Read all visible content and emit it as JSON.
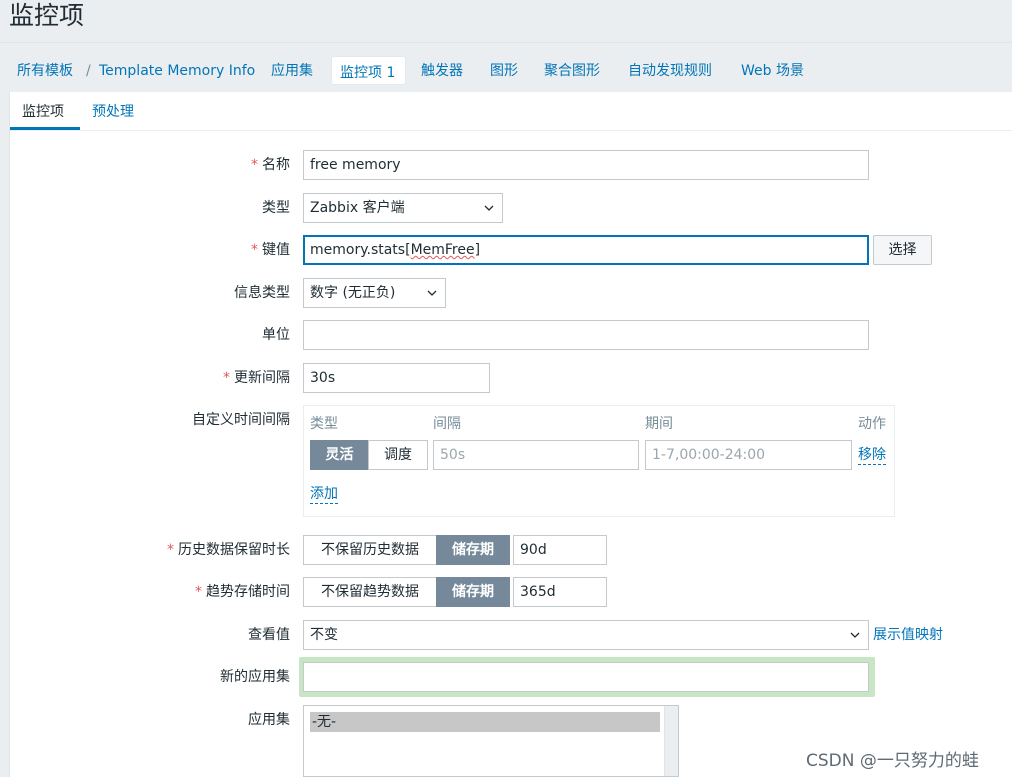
{
  "page": {
    "title": "监控项"
  },
  "nav": {
    "all_templates": "所有模板",
    "separator": "/",
    "template": "Template Memory Info",
    "applications": "应用集",
    "items": "监控项 1",
    "triggers": "触发器",
    "graphs": "图形",
    "screens": "聚合图形",
    "discovery": "自动发现规则",
    "web": "Web 场景"
  },
  "tabs": {
    "item": "监控项",
    "preprocessing": "预处理"
  },
  "form": {
    "required_mark": "*",
    "name": {
      "label": "名称",
      "value": "free memory"
    },
    "type": {
      "label": "类型",
      "value": "Zabbix 客户端"
    },
    "key": {
      "label": "键值",
      "value_prefix": "memory.stats[",
      "value_word": "MemFree",
      "value_suffix": "]",
      "button": "选择"
    },
    "info_type": {
      "label": "信息类型",
      "value": "数字 (无正负)"
    },
    "units": {
      "label": "单位",
      "value": ""
    },
    "update_interval": {
      "label": "更新间隔",
      "value": "30s"
    },
    "custom_intervals": {
      "label": "自定义时间间隔",
      "headers": {
        "type": "类型",
        "interval": "间隔",
        "period": "期间",
        "action": "动作"
      },
      "row": {
        "flexible": "灵活",
        "scheduling": "调度",
        "interval_placeholder": "50s",
        "period_placeholder": "1-7,00:00-24:00",
        "remove": "移除"
      },
      "add": "添加"
    },
    "history": {
      "label": "历史数据保留时长",
      "off_option": "不保留历史数据",
      "on_option": "储存期",
      "value": "90d"
    },
    "trends": {
      "label": "趋势存储时间",
      "off_option": "不保留趋势数据",
      "on_option": "储存期",
      "value": "365d"
    },
    "valuemap": {
      "label": "查看值",
      "value": "不变",
      "link": "展示值映射"
    },
    "new_application": {
      "label": "新的应用集",
      "value": ""
    },
    "applications": {
      "label": "应用集",
      "options": [
        "-无-"
      ]
    }
  },
  "watermark": "CSDN @一只努力的蛙",
  "colors": {
    "accent": "#0275b8",
    "required": "#e45959",
    "segment_active": "#76899a"
  }
}
